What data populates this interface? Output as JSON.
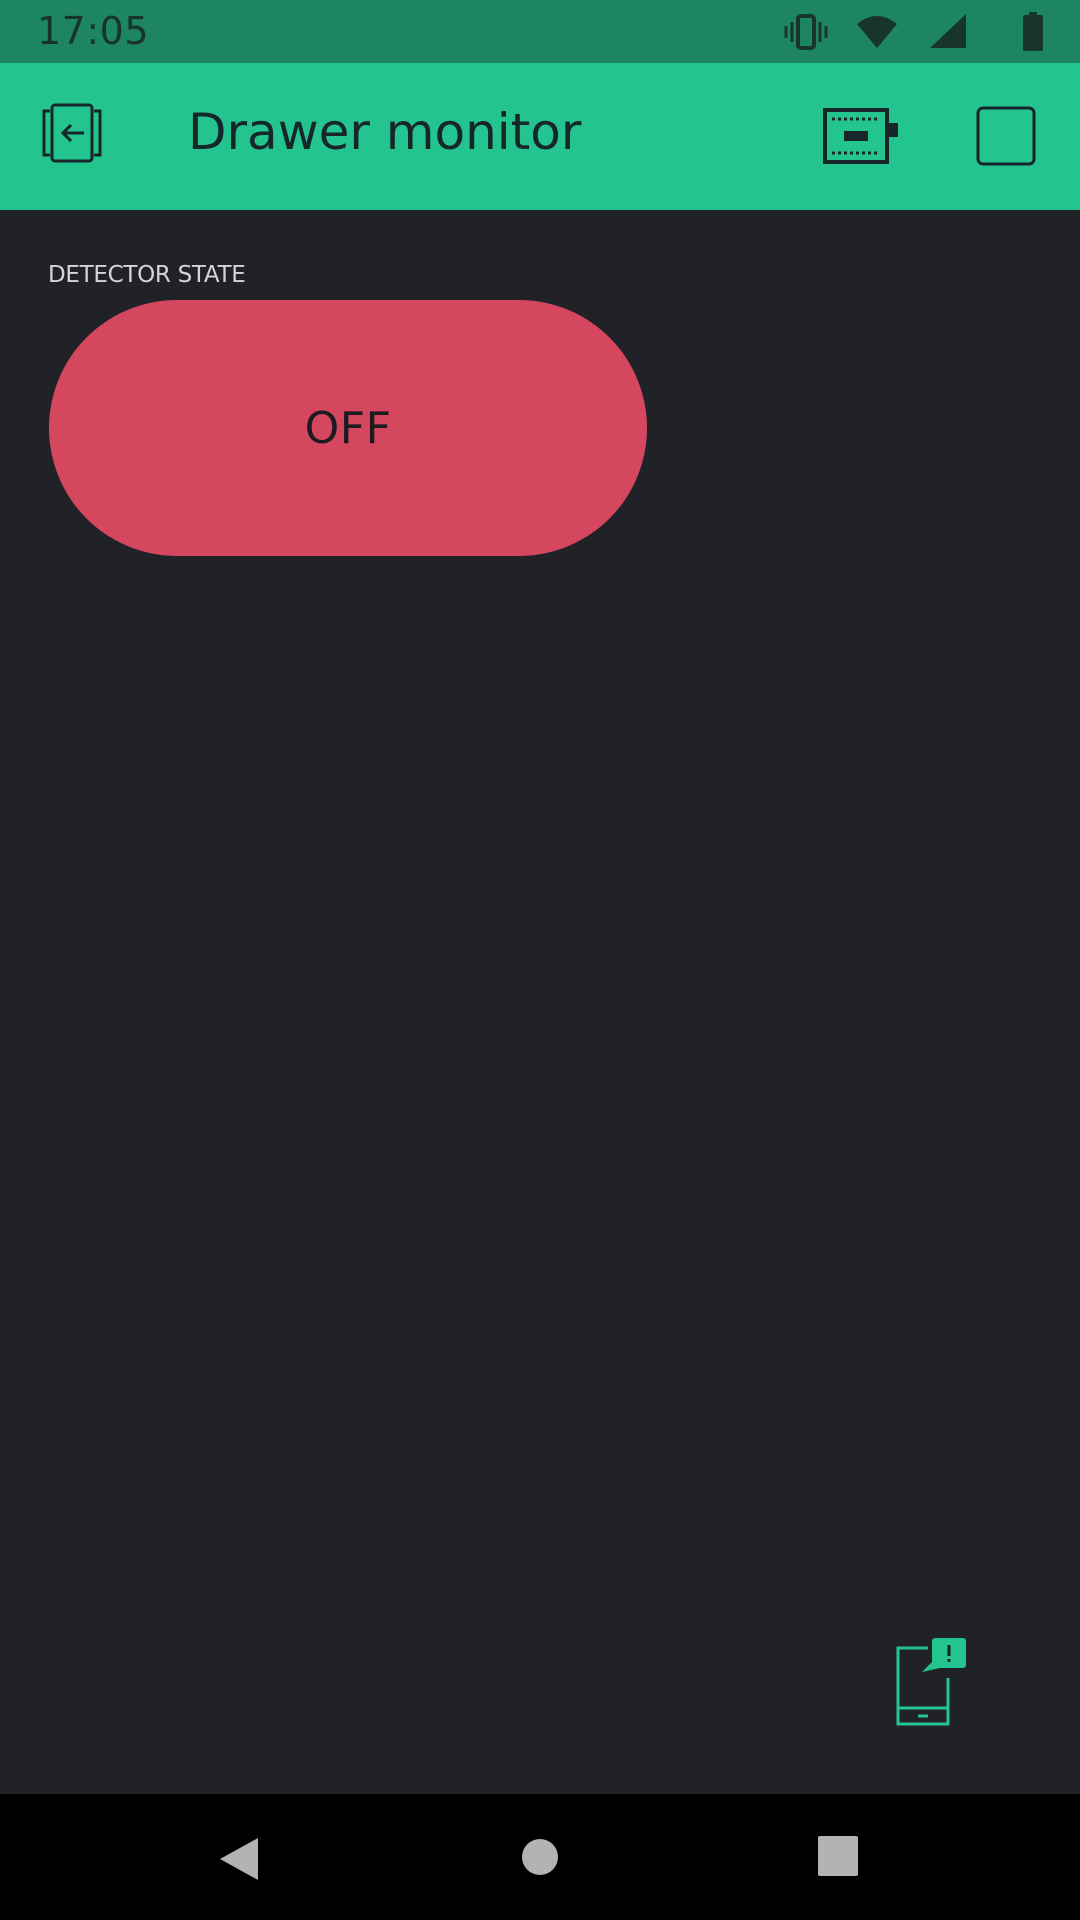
{
  "status_bar": {
    "time": "17:05",
    "icons": [
      "vibrate-icon",
      "wifi-icon",
      "cellular-signal-icon",
      "battery-icon"
    ]
  },
  "app_bar": {
    "title": "Drawer monitor",
    "icons": [
      "exit-project-icon",
      "device-board-icon",
      "play-icon"
    ]
  },
  "widgets": {
    "detector": {
      "label": "DETECTOR STATE",
      "state": "OFF",
      "color": "#d5465f"
    }
  },
  "fab": {
    "icon": "device-notification-icon"
  },
  "colors": {
    "accent": "#23c48e",
    "status_bar": "#1d8660",
    "background": "#212227",
    "button_off": "#d5465f"
  },
  "nav": {
    "icons": [
      "back-triangle-icon",
      "home-circle-icon",
      "recents-square-icon"
    ]
  }
}
